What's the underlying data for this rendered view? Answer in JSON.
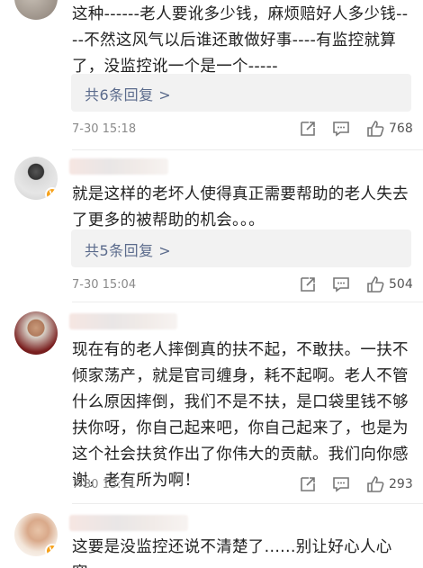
{
  "comments": [
    {
      "text": "这种------老人要讹多少钱，麻烦赔好人多少钱----不然这风气以后谁还敢做好事----有监控就算了，没监控讹一个是一个-----",
      "reply": "共6条回复 >",
      "time": "7-30 15:18",
      "likes": "768"
    },
    {
      "text": "就是这样的老坏人使得真正需要帮助的老人失去了更多的被帮助的机会。。。",
      "reply": "共5条回复 >",
      "time": "7-30 15:04",
      "likes": "504"
    },
    {
      "text": "现在有的老人摔倒真的扶不起，不敢扶。一扶不倾家荡产，就是官司缠身，耗不起啊。老人不管什么原因摔倒，我们不是不扶，是口袋里钱不够扶你呀，你自己起来吧，你自己起来了，也是为这个社会扶贫作出了你伟大的贡献。我们向你感谢，老有所为啊！",
      "time": "7-30 15:11",
      "likes": "293"
    },
    {
      "text": "这要是没监控还说不清楚了......别让好心人心寒。"
    }
  ],
  "icons": {
    "share": "share-icon",
    "comment": "comment-icon",
    "like": "thumbs-up-icon",
    "badge": "verified-badge-icon"
  }
}
